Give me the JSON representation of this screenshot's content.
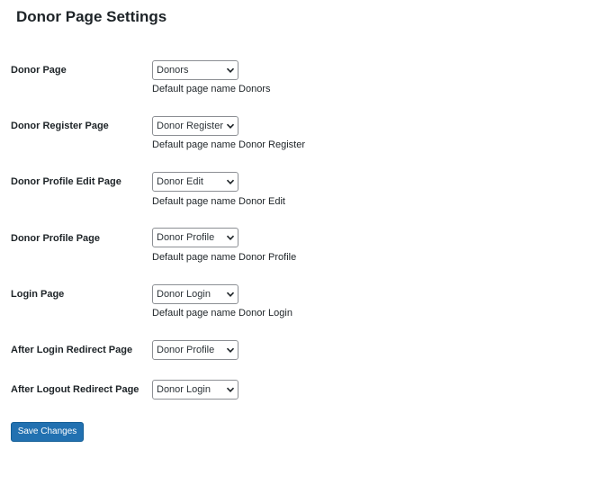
{
  "header": {
    "title": "Donor Page Settings"
  },
  "settings": [
    {
      "label": "Donor Page",
      "selected": "Donors",
      "description": "Default page name Donors"
    },
    {
      "label": "Donor Register Page",
      "selected": "Donor Register",
      "description": "Default page name Donor Register"
    },
    {
      "label": "Donor Profile Edit Page",
      "selected": "Donor Edit",
      "description": "Default page name Donor Edit"
    },
    {
      "label": "Donor Profile Page",
      "selected": "Donor Profile",
      "description": "Default page name Donor Profile"
    },
    {
      "label": "Login Page",
      "selected": "Donor Login",
      "description": "Default page name Donor Login"
    },
    {
      "label": "After Login Redirect Page",
      "selected": "Donor Profile"
    },
    {
      "label": "After Logout Redirect Page",
      "selected": "Donor Login"
    }
  ],
  "actions": {
    "save_label": "Save Changes"
  },
  "icons": {
    "select_arrow": "chevron-down-icon"
  },
  "colors": {
    "primary_button": "#2271b1",
    "primary_button_border": "#135e96",
    "text": "#1d2327",
    "select_border": "#8c8f94"
  }
}
